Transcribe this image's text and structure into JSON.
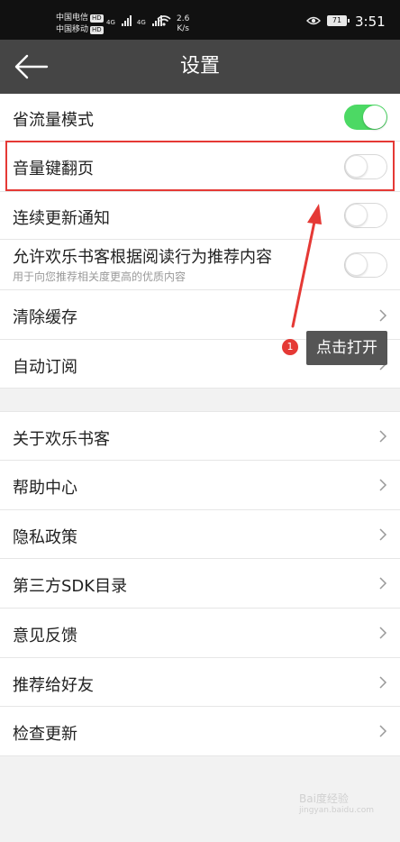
{
  "status_bar": {
    "carrier1": "中国电信",
    "carrier2": "中国移动",
    "hd1": "HD",
    "hd2": "HD",
    "net1": "4G",
    "net2": "4G",
    "speed_value": "2.6",
    "speed_unit": "K/s",
    "battery": "71",
    "time": "3:51"
  },
  "header": {
    "title": "设置",
    "back_icon": "back-arrow-icon"
  },
  "colors": {
    "header_bg": "#454545",
    "toggle_on": "#4cd964",
    "highlight": "#e53935"
  },
  "settings": {
    "data_saver": {
      "label": "省流量模式",
      "enabled": true
    },
    "volume_key_page": {
      "label": "音量键翻页",
      "enabled": false
    },
    "serial_update_notify": {
      "label": "连续更新通知",
      "enabled": false
    },
    "recommend": {
      "label": "允许欢乐书客根据阅读行为推荐内容",
      "sub": "用于向您推荐相关度更高的优质内容",
      "enabled": false
    },
    "clear_cache": {
      "label": "清除缓存"
    },
    "auto_subscribe": {
      "label": "自动订阅"
    }
  },
  "links": {
    "about": "关于欢乐书客",
    "help": "帮助中心",
    "privacy": "隐私政策",
    "sdk": "第三方SDK目录",
    "feedback": "意见反馈",
    "recommend_friend": "推荐给好友",
    "check_update": "检查更新"
  },
  "annotation": {
    "step": "1",
    "tip": "点击打开"
  },
  "watermark": {
    "brand": "Bai度经验",
    "url": "jingyan.baidu.com"
  }
}
